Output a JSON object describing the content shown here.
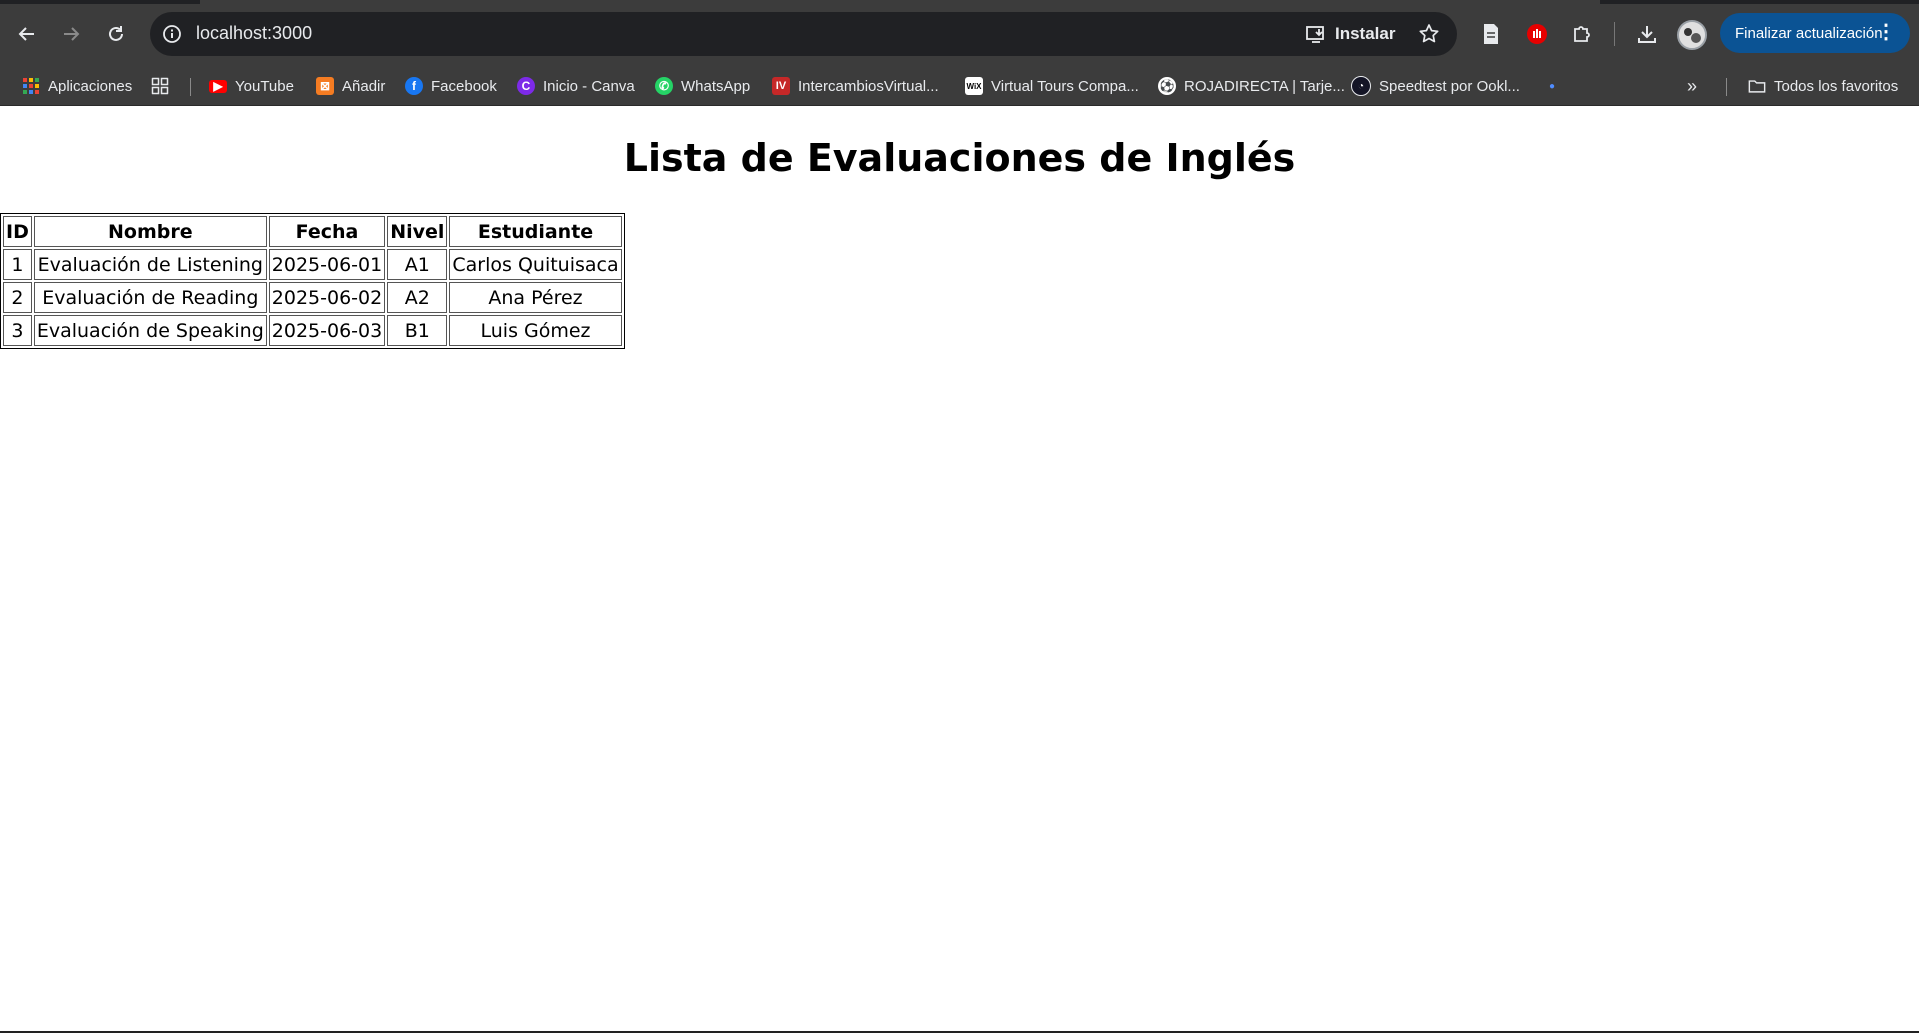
{
  "browser": {
    "url": "localhost:3000",
    "install_label": "Instalar",
    "update_label": "Finalizar actualización",
    "colors": {
      "chrome_bg": "#3c3c3c",
      "omnibox_bg": "#202124",
      "update_btn": "#0b5394"
    }
  },
  "bookmarks": {
    "apps_label": "Aplicaciones",
    "items": [
      {
        "label": "YouTube",
        "icon": "youtube-icon"
      },
      {
        "label": "Añadir",
        "icon": "xampp-icon"
      },
      {
        "label": "Facebook",
        "icon": "facebook-icon"
      },
      {
        "label": "Inicio - Canva",
        "icon": "canva-icon"
      },
      {
        "label": "WhatsApp",
        "icon": "whatsapp-icon"
      },
      {
        "label": "IntercambiosVirtual...",
        "icon": "iv-icon"
      },
      {
        "label": "Virtual Tours Compa...",
        "icon": "wix-icon"
      },
      {
        "label": "ROJADIRECTA | Tarje...",
        "icon": "ball-icon"
      },
      {
        "label": "Speedtest por Ookl...",
        "icon": "speedtest-icon"
      }
    ],
    "all_bookmarks_label": "Todos los favoritos"
  },
  "page": {
    "title": "Lista de Evaluaciones de Inglés",
    "table": {
      "headers": [
        "ID",
        "Nombre",
        "Fecha",
        "Nivel",
        "Estudiante"
      ],
      "rows": [
        [
          "1",
          "Evaluación de Listening",
          "2025-06-01",
          "A1",
          "Carlos Quituisaca"
        ],
        [
          "2",
          "Evaluación de Reading",
          "2025-06-02",
          "A2",
          "Ana Pérez"
        ],
        [
          "3",
          "Evaluación de Speaking",
          "2025-06-03",
          "B1",
          "Luis Gómez"
        ]
      ]
    }
  }
}
